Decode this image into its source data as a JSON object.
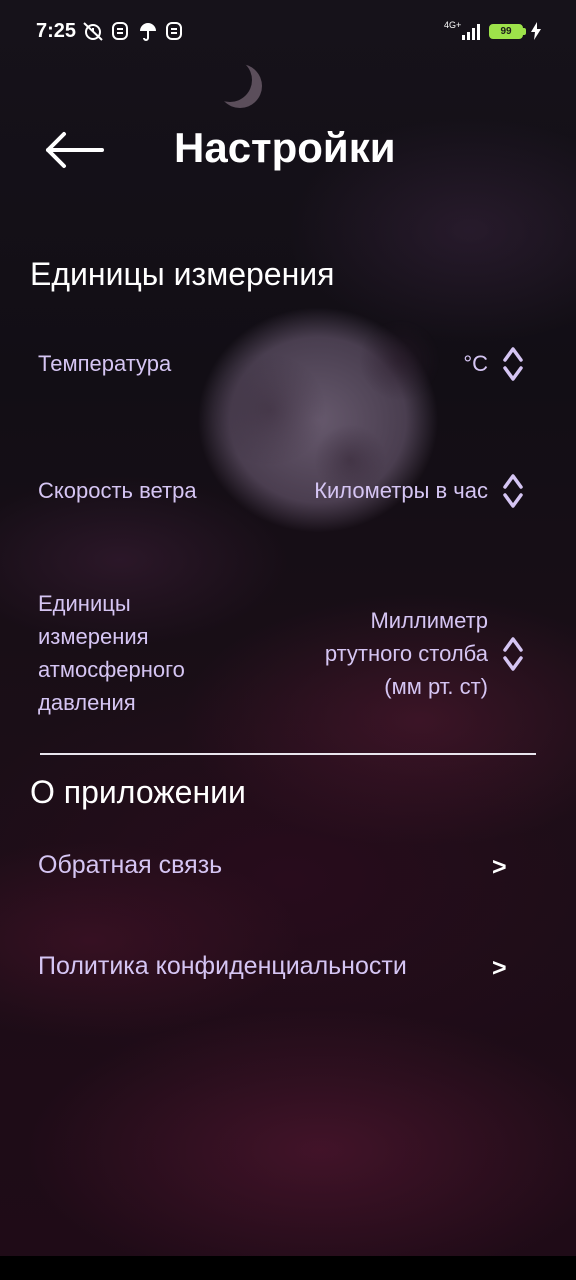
{
  "status_bar": {
    "time": "7:25",
    "network": "4G+",
    "battery": "99",
    "icons": [
      "muted-alarm-icon",
      "s-logo-icon",
      "umbrella-icon",
      "s-logo-icon",
      "signal-icon",
      "battery-icon",
      "charging-icon"
    ]
  },
  "header": {
    "title": "Настройки",
    "back_icon": "arrow-left-icon"
  },
  "units_section": {
    "title": "Единицы измерения",
    "items": [
      {
        "label": "Температура",
        "value": "°C"
      },
      {
        "label": "Скорость ветра",
        "value": "Километры в час"
      },
      {
        "label": "Единицы измерения атмосферного давления",
        "value": "Миллиметр ртутного столба (мм рт. ст)"
      }
    ]
  },
  "about_section": {
    "title": "О приложении",
    "items": [
      {
        "label": "Обратная связь",
        "chevron": ">"
      },
      {
        "label": "Политика конфиденциальности",
        "chevron": ">"
      }
    ]
  },
  "colors": {
    "label": "#d5c5f3",
    "battery": "#9de24a",
    "divider": "#e9e6ee"
  }
}
